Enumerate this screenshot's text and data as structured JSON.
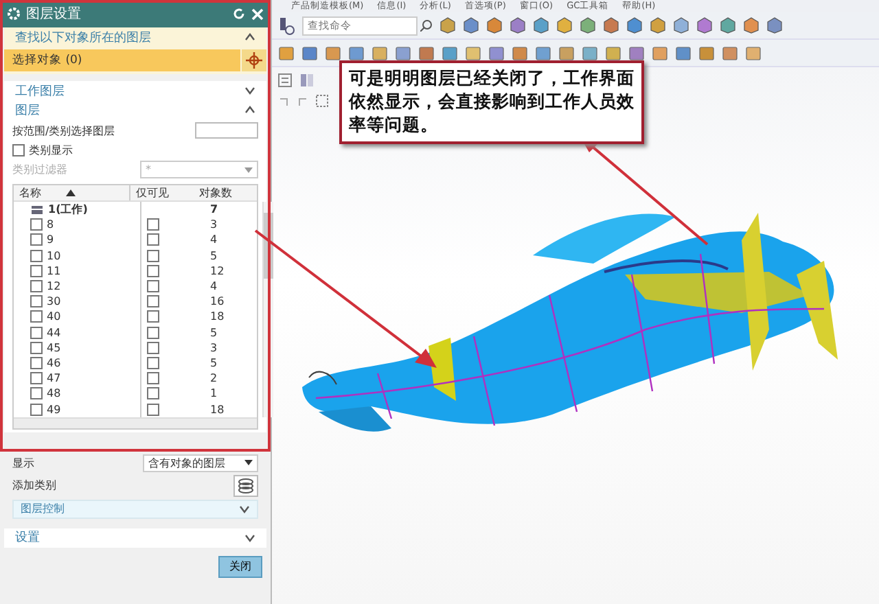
{
  "menu_bar": [
    "产品制造模板(M)",
    "信息(I)",
    "分析(L)",
    "首选项(P)",
    "窗口(O)",
    "GC工具箱",
    "帮助(H)"
  ],
  "toolbar": {
    "search_placeholder": "查找命令"
  },
  "dialog": {
    "title": "图层设置",
    "find_section": {
      "title": "查找以下对象所在的图层",
      "expanded": true,
      "select_label": "选择对象 (0)"
    },
    "work_layer_section": {
      "title": "工作图层",
      "expanded": false
    },
    "layer_section": {
      "title": "图层",
      "expanded": true,
      "range_label": "按范围/类别选择图层",
      "category_display": {
        "label": "类别显示",
        "checked": false
      },
      "category_filter": {
        "label": "类别过滤器",
        "value": "*",
        "disabled": true
      }
    },
    "table": {
      "columns": [
        "名称",
        "仅可见",
        "对象数"
      ],
      "rows": [
        {
          "kind": "work",
          "name": "1(工作)",
          "count": "7"
        },
        {
          "kind": "layer",
          "name": "8",
          "checked": false,
          "visible_only": false,
          "count": "3"
        },
        {
          "kind": "layer",
          "name": "9",
          "checked": false,
          "visible_only": false,
          "count": "4"
        },
        {
          "kind": "layer",
          "name": "10",
          "checked": false,
          "visible_only": false,
          "count": "5"
        },
        {
          "kind": "layer",
          "name": "11",
          "checked": false,
          "visible_only": false,
          "count": "12"
        },
        {
          "kind": "layer",
          "name": "12",
          "checked": false,
          "visible_only": false,
          "count": "4"
        },
        {
          "kind": "layer",
          "name": "30",
          "checked": false,
          "visible_only": false,
          "count": "16"
        },
        {
          "kind": "layer",
          "name": "40",
          "checked": false,
          "visible_only": false,
          "count": "18"
        },
        {
          "kind": "layer",
          "name": "44",
          "checked": false,
          "visible_only": false,
          "count": "5"
        },
        {
          "kind": "layer",
          "name": "45",
          "checked": false,
          "visible_only": false,
          "count": "3"
        },
        {
          "kind": "layer",
          "name": "46",
          "checked": false,
          "visible_only": false,
          "count": "5"
        },
        {
          "kind": "layer",
          "name": "47",
          "checked": false,
          "visible_only": false,
          "count": "2"
        },
        {
          "kind": "layer",
          "name": "48",
          "checked": false,
          "visible_only": false,
          "count": "1"
        },
        {
          "kind": "layer",
          "name": "49",
          "checked": false,
          "visible_only": false,
          "count": "18"
        }
      ]
    },
    "display": {
      "label": "显示",
      "value": "含有对象的图层"
    },
    "add_category_label": "添加类别",
    "layer_control": {
      "title": "图层控制",
      "expanded": false
    },
    "settings": {
      "title": "设置",
      "expanded": false
    },
    "close_button": "关闭"
  },
  "callout": "可是明明图层已经关闭了，工作界面依然显示，会直接影响到工作人员效率等问题。"
}
